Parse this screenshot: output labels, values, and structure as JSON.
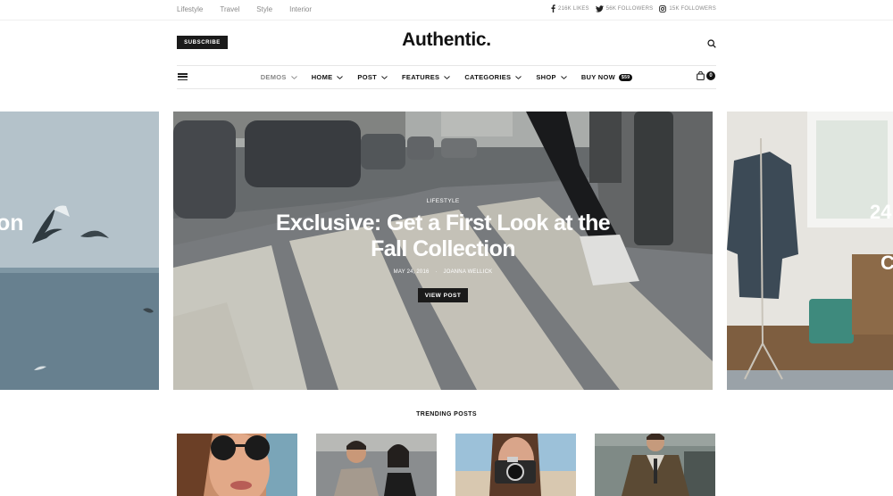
{
  "top_nav": {
    "links": [
      "Lifestyle",
      "Travel",
      "Style",
      "Interior"
    ]
  },
  "social": [
    {
      "icon": "facebook-icon",
      "label": "216K LIKES"
    },
    {
      "icon": "twitter-icon",
      "label": "56K FOLLOWERS"
    },
    {
      "icon": "instagram-icon",
      "label": "15K FOLLOWERS"
    }
  ],
  "header": {
    "subscribe_label": "SUBSCRIBE",
    "logo": "Authentic."
  },
  "main_nav": {
    "items": [
      {
        "label": "DEMOS",
        "dropdown": true,
        "active": false
      },
      {
        "label": "HOME",
        "dropdown": true
      },
      {
        "label": "POST",
        "dropdown": true
      },
      {
        "label": "FEATURES",
        "dropdown": true
      },
      {
        "label": "CATEGORIES",
        "dropdown": true
      },
      {
        "label": "SHOP",
        "dropdown": true
      },
      {
        "label": "BUY NOW",
        "badge": "$59"
      }
    ],
    "cart_count": "0"
  },
  "hero": {
    "category": "LIFESTYLE",
    "title": "Exclusive: Get a First Look at the Fall Collection",
    "date": "MAY 24, 2016",
    "author": "JOANNA WELLICK",
    "button_label": "VIEW POST",
    "left_partial_text": "on",
    "right_partial_text_1": "24",
    "right_partial_text_2": "C"
  },
  "trending": {
    "title": "TRENDING POSTS"
  },
  "colors": {
    "dark": "#1a1a1a",
    "muted": "#8a8a8a"
  }
}
